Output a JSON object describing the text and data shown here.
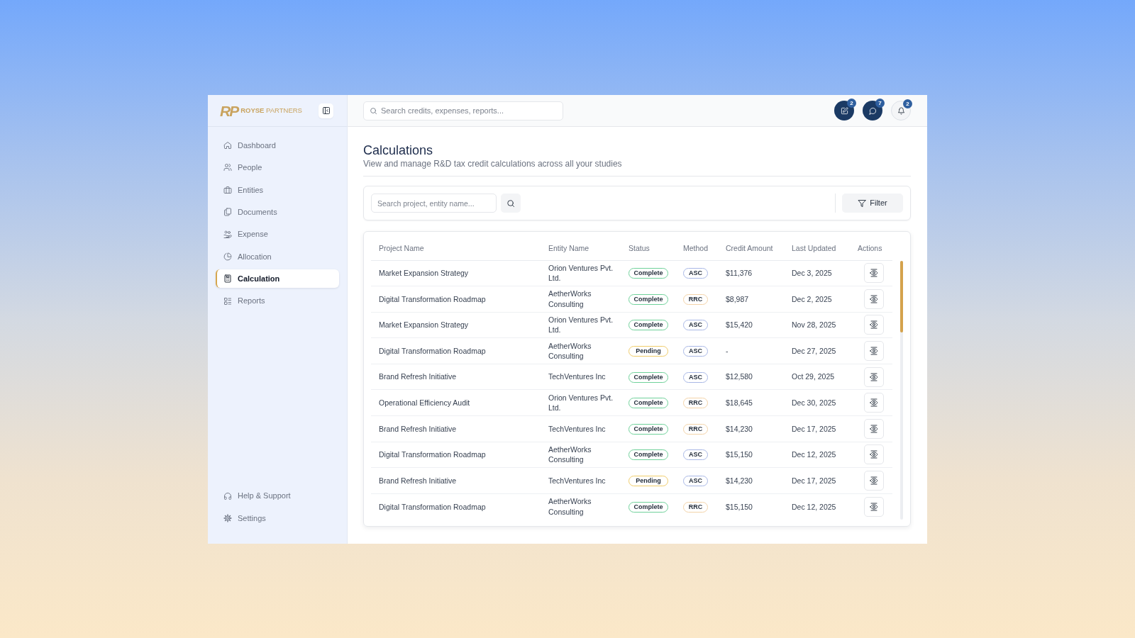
{
  "sidebar": {
    "brand": {
      "monogram": "RP",
      "name": "**ROYSE** PARTNERS"
    },
    "items": [
      {
        "label": "Dashboard",
        "selected": false
      },
      {
        "label": "People",
        "selected": false
      },
      {
        "label": "Entities",
        "selected": false
      },
      {
        "label": "Documents",
        "selected": false
      },
      {
        "label": "Expense",
        "selected": false
      },
      {
        "label": "Allocation",
        "selected": false
      },
      {
        "label": "Calculation",
        "selected": true
      },
      {
        "label": "Reports",
        "selected": false
      }
    ],
    "footer_items": [
      "Help & Support",
      "Settings"
    ]
  },
  "header": {
    "search": {
      "placeholder": "Search credits, expenses, reports..."
    },
    "actions": [
      {
        "kind": "filled",
        "badge": "2"
      },
      {
        "kind": "filled",
        "badge": "7"
      },
      {
        "kind": "outline",
        "badge": "2"
      }
    ]
  },
  "page": {
    "title": "Calculations",
    "subtitle": "View and manage R&D tax credit calculations across all your studies"
  },
  "toolbar": {
    "search": {
      "placeholder": "Search project, entity name..."
    },
    "filter_button": "Filter"
  },
  "table": {
    "columns": [
      "Project Name",
      "Entity Name",
      "Status",
      "Method",
      "Credit Amount",
      "Last Updated",
      "Actions"
    ],
    "rows": [
      {
        "project": "Market Expansion Strategy",
        "entity": "Orion Ventures Pvt. Ltd.",
        "status": {
          "label": "Complete",
          "color": "#6fd19a"
        },
        "method": {
          "label": "ASC",
          "color": "#a9b8e6"
        },
        "credit_amount": "$11,376",
        "last_updated": "Dec 3, 2025"
      },
      {
        "project": "Digital Transformation Roadmap",
        "entity": "AetherWorks Consulting",
        "status": {
          "label": "Complete",
          "color": "#6fd19a"
        },
        "method": {
          "label": "RRC",
          "color": "#f3d3a8"
        },
        "credit_amount": "$8,987",
        "last_updated": "Dec 2, 2025"
      },
      {
        "project": "Market Expansion Strategy",
        "entity": "Orion Ventures Pvt. Ltd.",
        "status": {
          "label": "Complete",
          "color": "#6fd19a"
        },
        "method": {
          "label": "ASC",
          "color": "#a9b8e6"
        },
        "credit_amount": "$15,420",
        "last_updated": "Nov 28, 2025"
      },
      {
        "project": "Digital Transformation Roadmap",
        "entity": "AetherWorks Consulting",
        "status": {
          "label": "Pending",
          "color": "#f0cc6a"
        },
        "method": {
          "label": "ASC",
          "color": "#a9b8e6"
        },
        "credit_amount": "-",
        "last_updated": "Dec 27, 2025"
      },
      {
        "project": "Brand Refresh Initiative",
        "entity": "TechVentures Inc",
        "status": {
          "label": "Complete",
          "color": "#6fd19a"
        },
        "method": {
          "label": "ASC",
          "color": "#a9b8e6"
        },
        "credit_amount": "$12,580",
        "last_updated": "Oct 29, 2025"
      },
      {
        "project": "Operational Efficiency Audit",
        "entity": "Orion Ventures Pvt. Ltd.",
        "status": {
          "label": "Complete",
          "color": "#6fd19a"
        },
        "method": {
          "label": "RRC",
          "color": "#f3d3a8"
        },
        "credit_amount": "$18,645",
        "last_updated": "Dec 30, 2025"
      },
      {
        "project": "Brand Refresh Initiative",
        "entity": "TechVentures Inc",
        "status": {
          "label": "Complete",
          "color": "#6fd19a"
        },
        "method": {
          "label": "RRC",
          "color": "#f3d3a8"
        },
        "credit_amount": "$14,230",
        "last_updated": "Dec 17, 2025"
      },
      {
        "project": "Digital Transformation Roadmap",
        "entity": "AetherWorks Consulting",
        "status": {
          "label": "Complete",
          "color": "#6fd19a"
        },
        "method": {
          "label": "ASC",
          "color": "#a9b8e6"
        },
        "credit_amount": "$15,150",
        "last_updated": "Dec 12, 2025"
      },
      {
        "project": "Brand Refresh Initiative",
        "entity": "TechVentures Inc",
        "status": {
          "label": "Pending",
          "color": "#f0cc6a"
        },
        "method": {
          "label": "ASC",
          "color": "#a9b8e6"
        },
        "credit_amount": "$14,230",
        "last_updated": "Dec 17, 2025"
      },
      {
        "project": "Digital Transformation Roadmap",
        "entity": "AetherWorks Consulting",
        "status": {
          "label": "Complete",
          "color": "#6fd19a"
        },
        "method": {
          "label": "RRC",
          "color": "#f3d3a8"
        },
        "credit_amount": "$15,150",
        "last_updated": "Dec 12, 2025"
      }
    ]
  }
}
